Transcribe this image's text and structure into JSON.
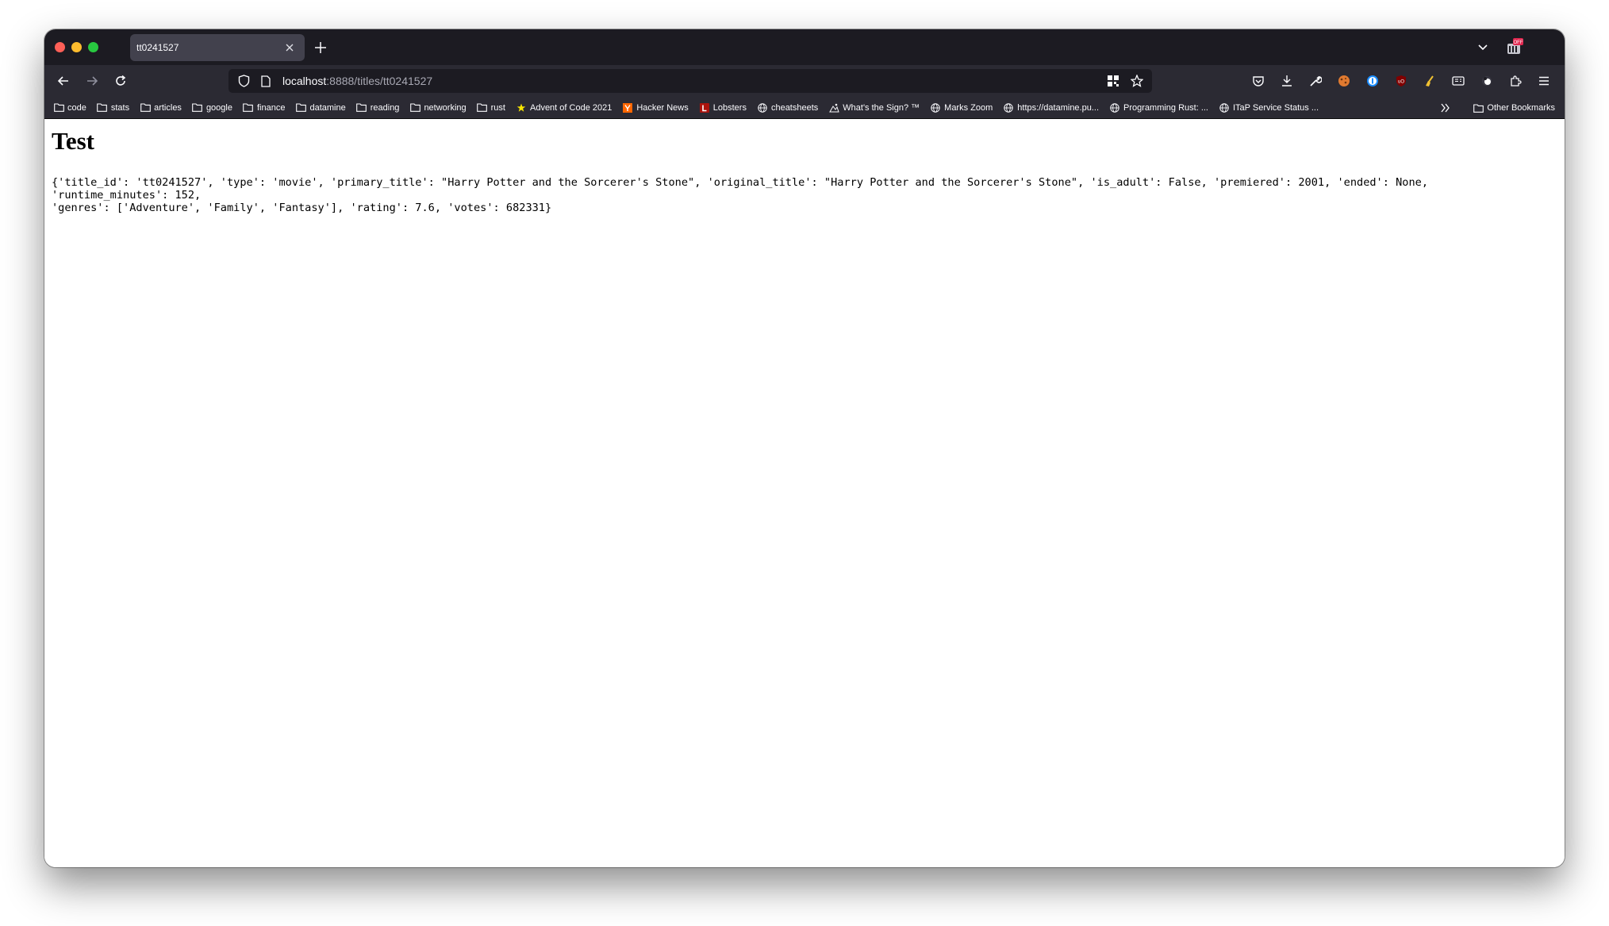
{
  "tab": {
    "title": "tt0241527"
  },
  "toolbar": {
    "url_host": "localhost",
    "url_path": ":8888/titles/tt0241527"
  },
  "bookmarks": [
    {
      "label": "code",
      "icon": "folder-icon"
    },
    {
      "label": "stats",
      "icon": "folder-icon"
    },
    {
      "label": "articles",
      "icon": "folder-icon"
    },
    {
      "label": "google",
      "icon": "folder-icon"
    },
    {
      "label": "finance",
      "icon": "folder-icon"
    },
    {
      "label": "datamine",
      "icon": "folder-icon"
    },
    {
      "label": "reading",
      "icon": "folder-icon"
    },
    {
      "label": "networking",
      "icon": "folder-icon"
    },
    {
      "label": "rust",
      "icon": "folder-icon"
    },
    {
      "label": "Advent of Code 2021",
      "icon": "star-icon"
    },
    {
      "label": "Hacker News",
      "icon": "hacker-news-icon"
    },
    {
      "label": "Lobsters",
      "icon": "lobsters-icon"
    },
    {
      "label": "cheatsheets",
      "icon": "globe-icon"
    },
    {
      "label": "What's the Sign? ™",
      "icon": "sign-icon"
    },
    {
      "label": "Marks Zoom",
      "icon": "globe-icon"
    },
    {
      "label": "https://datamine.pu...",
      "icon": "globe-icon"
    },
    {
      "label": "Programming Rust: ...",
      "icon": "globe-icon"
    },
    {
      "label": "ITaP Service Status ...",
      "icon": "globe-icon"
    }
  ],
  "other_bookmarks": "Other Bookmarks",
  "page": {
    "heading": "Test",
    "record_line1": "{'title_id': 'tt0241527', 'type': 'movie', 'primary_title': \"Harry Potter and the Sorcerer's Stone\", 'original_title': \"Harry Potter and the Sorcerer's Stone\", 'is_adult': False, 'premiered': 2001, 'ended': None, 'runtime_minutes': 152,",
    "record_line2": "'genres': ['Adventure', 'Family', 'Fantasy'], 'rating': 7.6, 'votes': 682331}"
  },
  "colors": {
    "tab_strip": "#1c1b22",
    "toolbar": "#2b2a33",
    "active_tab": "#42414d",
    "url_field": "#1c1b22",
    "hacker_news": "#ff6600",
    "lobsters": "#ac130d"
  }
}
